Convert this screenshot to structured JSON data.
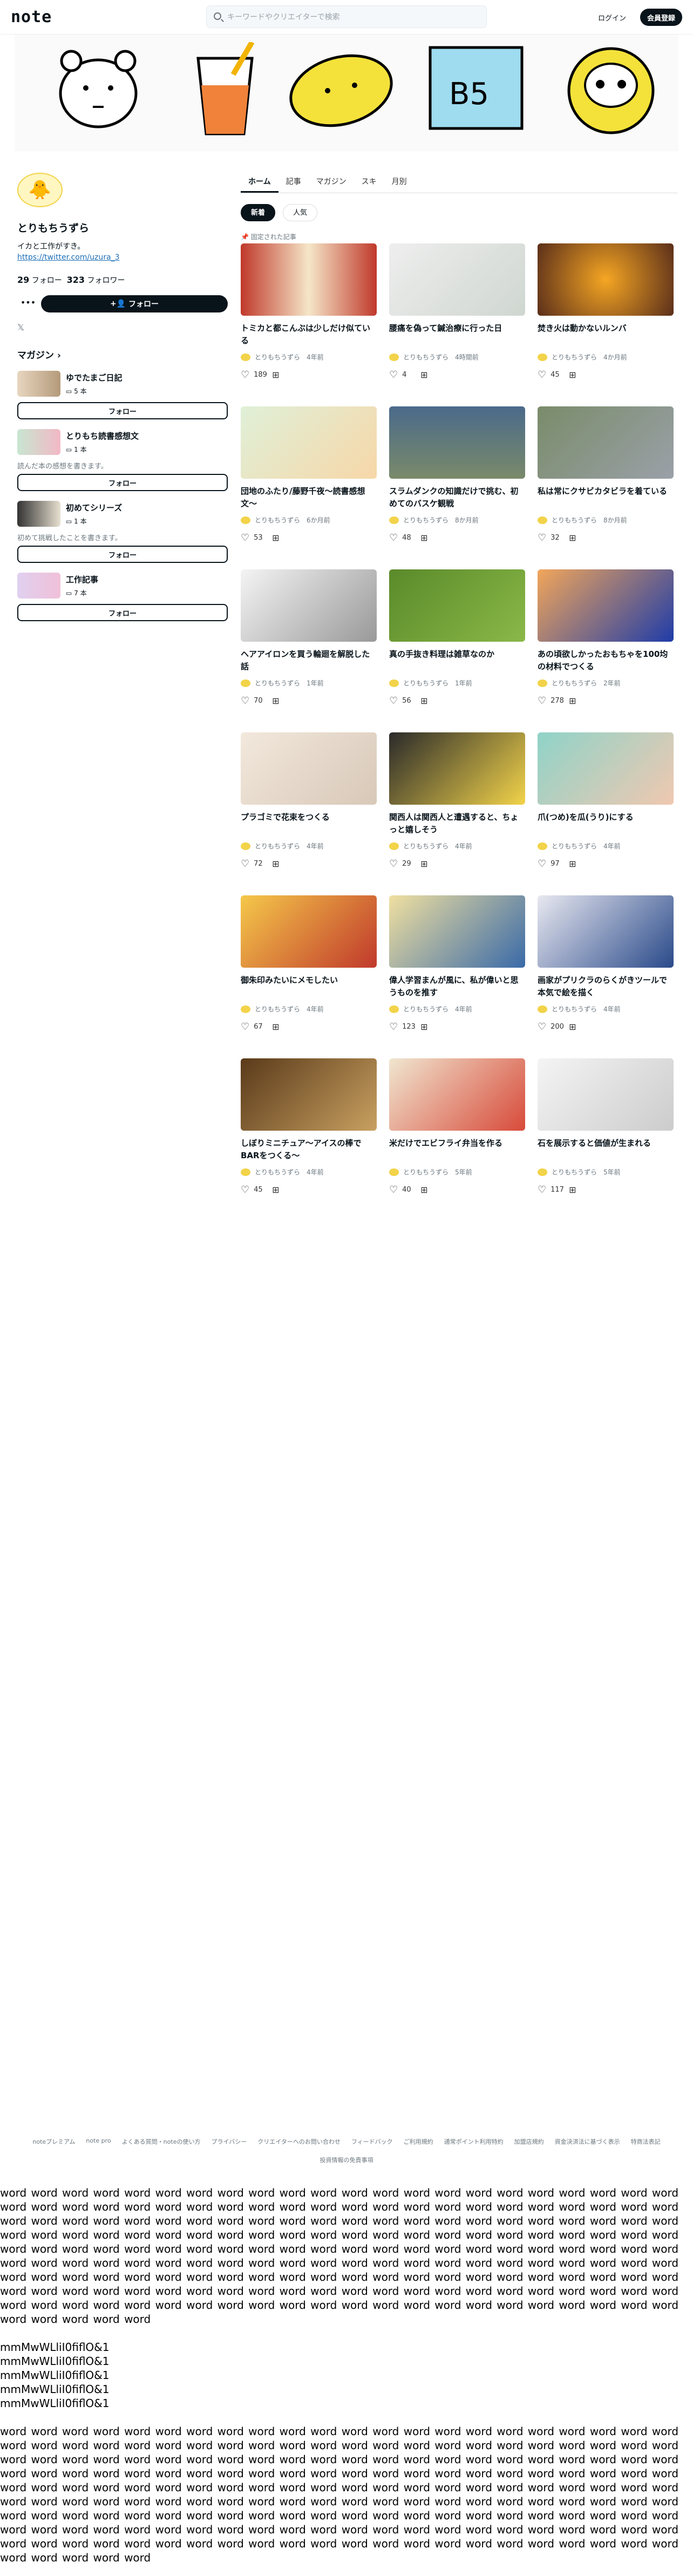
{
  "header": {
    "logo": "note",
    "search_placeholder": "キーワードやクリエイターで検索",
    "login": "ログイン",
    "register": "会員登録"
  },
  "profile": {
    "name": "とりもちうずら",
    "bio": "イカと工作がすき。",
    "link": "https://twitter.com/uzura_3",
    "followers": "29",
    "followers_label": "フォロー",
    "following": "323",
    "following_label": "フォロワー",
    "follow_label": "フォロー"
  },
  "magazines": {
    "heading": "マガジン",
    "items": [
      {
        "title": "ゆでたまご日記",
        "count": "5 本",
        "desc": "",
        "follow": "フォロー"
      },
      {
        "title": "とりもち読書感想文",
        "count": "1 本",
        "desc": "読んだ本の感想を書きます。",
        "follow": "フォロー"
      },
      {
        "title": "初めてシリーズ",
        "count": "1 本",
        "desc": "初めて挑戦したことを書きます。",
        "follow": "フォロー"
      },
      {
        "title": "工作記事",
        "count": "7 本",
        "desc": "",
        "follow": "フォロー"
      }
    ]
  },
  "tabs": [
    "ホーム",
    "記事",
    "マガジン",
    "スキ",
    "月別"
  ],
  "chips": [
    "新着",
    "人気"
  ],
  "pinned": "固定された記事",
  "articles": [
    {
      "title": "トミカと都こんぶは少しだけ似ている",
      "author": "とりもちうずら",
      "time": "4年前",
      "likes": "189"
    },
    {
      "title": "腰痛を偽って鍼治療に行った日",
      "author": "とりもちうずら",
      "time": "4時間前",
      "likes": "4"
    },
    {
      "title": "焚き火は動かないルンバ",
      "author": "とりもちうずら",
      "time": "4か月前",
      "likes": "45"
    },
    {
      "title": "団地のふたり/藤野千夜〜読書感想文〜",
      "author": "とりもちうずら",
      "time": "6か月前",
      "likes": "53"
    },
    {
      "title": "スラムダンクの知識だけで挑む、初めてのバスケ観戦",
      "author": "とりもちうずら",
      "time": "8か月前",
      "likes": "48"
    },
    {
      "title": "私は常にクサビカタビラを着ている",
      "author": "とりもちうずら",
      "time": "8か月前",
      "likes": "32"
    },
    {
      "title": "ヘアアイロンを買う輪廻を解脱した話",
      "author": "とりもちうずら",
      "time": "1年前",
      "likes": "70"
    },
    {
      "title": "真の手抜き料理は雑草なのか",
      "author": "とりもちうずら",
      "time": "1年前",
      "likes": "56"
    },
    {
      "title": "あの頃欲しかったおもちゃを100均の材料でつくる",
      "author": "とりもちうずら",
      "time": "2年前",
      "likes": "278"
    },
    {
      "title": "プラゴミで花束をつくる",
      "author": "とりもちうずら",
      "time": "4年前",
      "likes": "72"
    },
    {
      "title": "関西人は関西人と遭遇すると、ちょっと嬉しそう",
      "author": "とりもちうずら",
      "time": "4年前",
      "likes": "29"
    },
    {
      "title": "爪(つめ)を瓜(うり)にする",
      "author": "とりもちうずら",
      "time": "4年前",
      "likes": "97"
    },
    {
      "title": "御朱印みたいにメモしたい",
      "author": "とりもちうずら",
      "time": "4年前",
      "likes": "67"
    },
    {
      "title": "偉人学習まんが風に、私が偉いと思うものを推す",
      "author": "とりもちうずら",
      "time": "4年前",
      "likes": "123"
    },
    {
      "title": "画家がプリクラのらくがきツールで本気で絵を描く",
      "author": "とりもちうずら",
      "time": "4年前",
      "likes": "200"
    },
    {
      "title": "しぼりミニチュア〜アイスの棒でBARをつくる〜",
      "author": "とりもちうずら",
      "time": "4年前",
      "likes": "45"
    },
    {
      "title": "米だけでエビフライ弁当を作る",
      "author": "とりもちうずら",
      "time": "5年前",
      "likes": "40"
    },
    {
      "title": "石を展示すると価値が生まれる",
      "author": "とりもちうずら",
      "time": "5年前",
      "likes": "117"
    }
  ],
  "footer": {
    "links": [
      "noteプレミアム",
      "note pro",
      "よくある質問・noteの使い方",
      "プライバシー",
      "クリエイターへのお問い合わせ",
      "フィードバック",
      "ご利用規約",
      "通常ポイント利用特約",
      "加盟店規約",
      "資金決済法に基づく表示",
      "特商法表記",
      "投資情報の免責事項"
    ]
  },
  "test_text": {
    "words": "word word word word word word word word word word word word word word word word word word word word word word word word word word word word word word word word word word word word word word word word word word word word word word word word word word word word word word word word word word word word word word word word word word word word word word word word word word word word word word word word word word word word word word word word word word word word word word word word word word word word word word word word word word word word word word word word word word word word word word word word word word word word word word word word word word word word word word word word word word word word word word word word word word word word word word word word word word word word word word word word word word word word word word word word word word word word word word word word word word word word word word word word word word word word word word word word word word word word word word word word word word word",
    "lines": [
      "mmMwWLliI0fiflO&1",
      "mmMwWLliI0fiflO&1",
      "mmMwWLliI0fiflO&1",
      "mmMwWLliI0fiflO&1",
      "mmMwWLliI0fiflO&1"
    ]
  }
}
